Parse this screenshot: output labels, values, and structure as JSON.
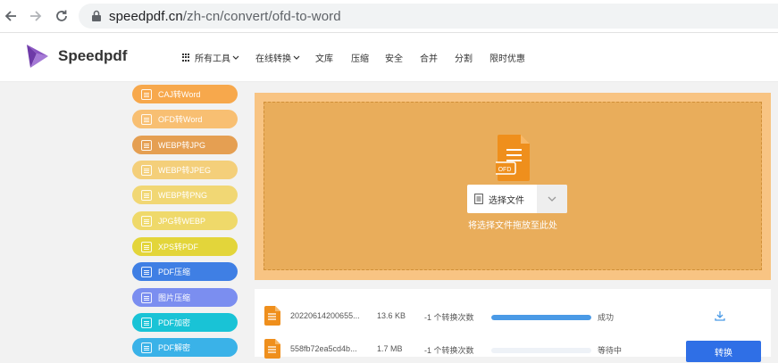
{
  "browser": {
    "url_domain": "speedpdf.cn",
    "url_path": "/zh-cn/convert/ofd-to-word"
  },
  "header": {
    "logo_text": "Speedpdf",
    "nav": [
      {
        "label": "所有工具"
      },
      {
        "label": "在线转换"
      },
      {
        "label": "文库"
      },
      {
        "label": "压缩"
      },
      {
        "label": "安全"
      },
      {
        "label": "合并"
      },
      {
        "label": "分割"
      },
      {
        "label": "限时优惠"
      }
    ]
  },
  "sidebar": {
    "items": [
      {
        "label": "CAJ转Word",
        "color": "#f7a84c"
      },
      {
        "label": "OFD转Word",
        "color": "#f8bf72"
      },
      {
        "label": "WEBP转JPG",
        "color": "#e59f52"
      },
      {
        "label": "WEBP转JPEG",
        "color": "#f4cf7a"
      },
      {
        "label": "WEBP转PNG",
        "color": "#f1d774"
      },
      {
        "label": "JPG转WEBP",
        "color": "#efd96a"
      },
      {
        "label": "XPS转PDF",
        "color": "#e3d53a"
      },
      {
        "label": "PDF压缩",
        "color": "#3f7fe4"
      },
      {
        "label": "图片压缩",
        "color": "#7b8ef0"
      },
      {
        "label": "PDF加密",
        "color": "#19c3d6"
      },
      {
        "label": "PDF解密",
        "color": "#3ab2e8"
      }
    ]
  },
  "upload": {
    "file_icon_label": "OFD",
    "select_label": "选择文件",
    "drop_hint": "将选择文件拖放至此处"
  },
  "files": [
    {
      "name": "20220614200655...",
      "size": "13.6 KB",
      "count": "-1 个转换次数",
      "progress": 1.0,
      "status": "成功",
      "action": "download"
    },
    {
      "name": "558fb72ea5cd4b...",
      "size": "1.7 MB",
      "count": "-1 个转换次数",
      "progress": 0.0,
      "status": "等待中",
      "action_label": "转换"
    }
  ]
}
